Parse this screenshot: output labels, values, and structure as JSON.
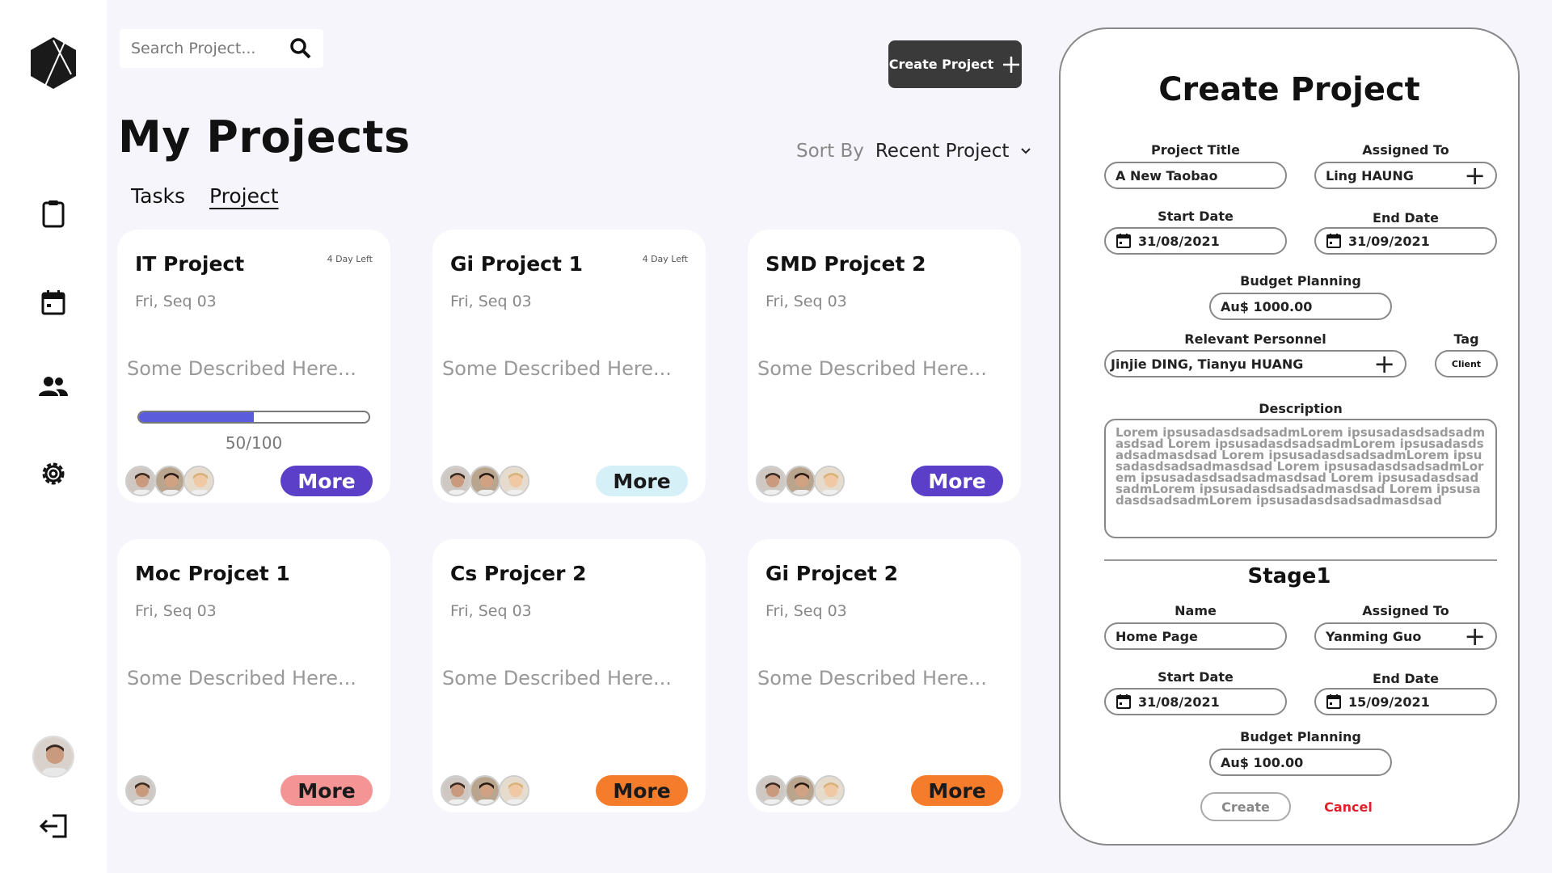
{
  "sidebar": {
    "logo": "hexagon-logo",
    "items": [
      {
        "icon": "clipboard-icon"
      },
      {
        "icon": "calendar-icon"
      },
      {
        "icon": "people-icon"
      },
      {
        "icon": "gear-icon"
      }
    ],
    "logout_icon": "logout-icon"
  },
  "search": {
    "placeholder": "Search Project..."
  },
  "header": {
    "create_label": "Create Project",
    "title": "My Projects",
    "sort_label": "Sort By",
    "sort_value": "Recent Project"
  },
  "tabs": [
    {
      "label": "Tasks",
      "active": false
    },
    {
      "label": "Project",
      "active": true
    }
  ],
  "cards": [
    {
      "title": "IT Project",
      "day_left": "4 Day Left",
      "date": "Fri, Seq 03",
      "desc": "Some Described Here...",
      "progress": 50,
      "progress_text": "50/100",
      "more_label": "More",
      "more_bg": "#5b3fc8",
      "more_fg": "#ffffff",
      "avatars": 3
    },
    {
      "title": "Gi Project 1",
      "day_left": "4 Day Left",
      "date": "Fri, Seq 03",
      "desc": "Some Described Here...",
      "more_label": "More",
      "more_bg": "#d6f0f7",
      "more_fg": "#1a1a1a",
      "avatars": 3
    },
    {
      "title": "SMD Projcet 2",
      "day_left": "",
      "date": "Fri, Seq 03",
      "desc": "Some Described Here...",
      "more_label": "More",
      "more_bg": "#5b3fc8",
      "more_fg": "#ffffff",
      "avatars": 3
    },
    {
      "title": "Moc Projcet 1",
      "day_left": "",
      "date": "Fri, Seq 03",
      "desc": "Some Described Here...",
      "more_label": "More",
      "more_bg": "#f49494",
      "more_fg": "#1a1a1a",
      "avatars": 1
    },
    {
      "title": "Cs Projcer 2",
      "day_left": "",
      "date": "Fri, Seq 03",
      "desc": "Some Described Here...",
      "more_label": "More",
      "more_bg": "#f57c2a",
      "more_fg": "#1a1a1a",
      "avatars": 3
    },
    {
      "title": "Gi Projcet 2",
      "day_left": "",
      "date": "Fri, Seq 03",
      "desc": "Some Described Here...",
      "more_label": "More",
      "more_bg": "#f57c2a",
      "more_fg": "#1a1a1a",
      "avatars": 3
    }
  ],
  "panel": {
    "title": "Create Project",
    "project_title_label": "Project Title",
    "project_title_value": "A New Taobao",
    "assigned_label": "Assigned To",
    "assigned_value": "Ling HAUNG",
    "start_label": "Start Date",
    "start_value": "31/08/2021",
    "end_label": "End Date",
    "end_value": "31/09/2021",
    "budget_label": "Budget Planning",
    "budget_value": "Au$ 1000.00",
    "personnel_label": "Relevant Personnel",
    "personnel_value": "Jinjie DING, Tianyu HUANG",
    "tag_label": "Tag",
    "tag_value": "Client",
    "description_label": "Description",
    "description_value": "Lorem ipsusadasdsadsadmLorem ipsusadasdsadsadmasdsad Lorem ipsusadasdsadsadmLorem ipsusadasdsadsadmasdsad Lorem ipsusadasdsadsadmLorem ipsusadasdsadsadmasdsad Lorem ipsusadasdsadsadmLorem ipsusadasdsadsadmasdsad Lorem ipsusadasdsadsadmLorem ipsusadasdsadsadmasdsad Lorem ipsusadasdsadsadmLorem ipsusadasdsadsadmasdsad",
    "stage": {
      "title": "Stage1",
      "name_label": "Name",
      "name_value": "Home Page",
      "assigned_label": "Assigned To",
      "assigned_value": "Yanming Guo",
      "start_label": "Start Date",
      "start_value": "31/08/2021",
      "end_label": "End Date",
      "end_value": "15/09/2021",
      "budget_label": "Budget Planning",
      "budget_value": "Au$ 100.00"
    },
    "create_label": "Create",
    "cancel_label": "Cancel"
  }
}
